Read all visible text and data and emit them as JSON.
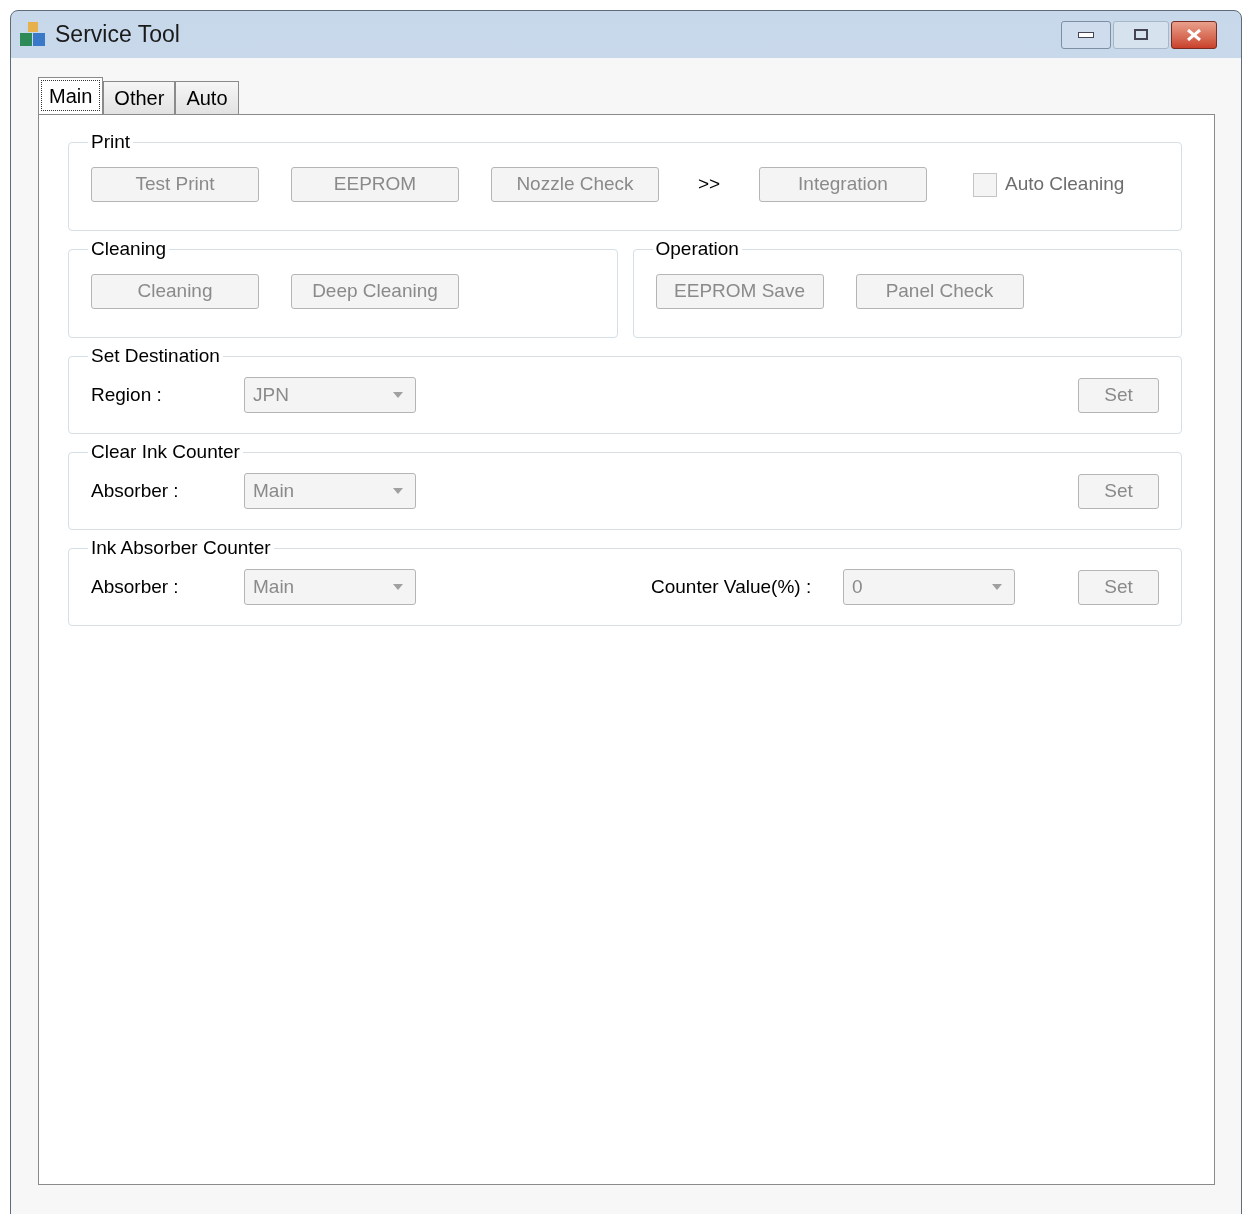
{
  "window": {
    "title": "Service Tool"
  },
  "tabs": [
    {
      "label": "Main",
      "selected": true
    },
    {
      "label": "Other",
      "selected": false
    },
    {
      "label": "Auto",
      "selected": false
    }
  ],
  "sections": [
    {
      "kind": "group",
      "title": "Print",
      "items": [
        {
          "kind": "button",
          "label": "Test Print",
          "disabled": true
        },
        {
          "kind": "button",
          "label": "EEPROM",
          "disabled": true
        },
        {
          "kind": "button",
          "label": "Nozzle Check",
          "disabled": true
        },
        {
          "kind": "text",
          "label": ">>"
        },
        {
          "kind": "button",
          "label": "Integration",
          "disabled": true
        },
        {
          "kind": "checkbox",
          "label": "Auto Cleaning",
          "checked": false,
          "disabled": true
        }
      ]
    },
    {
      "kind": "pair",
      "groups": [
        {
          "title": "Cleaning",
          "items": [
            {
              "kind": "button",
              "label": "Cleaning",
              "disabled": true
            },
            {
              "kind": "button",
              "label": "Deep Cleaning",
              "disabled": true
            }
          ]
        },
        {
          "title": "Operation",
          "items": [
            {
              "kind": "button",
              "label": "EEPROM Save",
              "disabled": true
            },
            {
              "kind": "button",
              "label": "Panel Check",
              "disabled": true
            }
          ]
        }
      ]
    },
    {
      "kind": "group",
      "title": "Set Destination",
      "items": [
        {
          "kind": "label",
          "label": "Region :"
        },
        {
          "kind": "combo",
          "value": "JPN",
          "disabled": true
        },
        {
          "kind": "button",
          "label": "Set",
          "disabled": true
        }
      ]
    },
    {
      "kind": "group",
      "title": "Clear Ink Counter",
      "items": [
        {
          "kind": "label",
          "label": "Absorber :"
        },
        {
          "kind": "combo",
          "value": "Main",
          "disabled": true
        },
        {
          "kind": "button",
          "label": "Set",
          "disabled": true
        }
      ]
    },
    {
      "kind": "group",
      "title": "Ink Absorber Counter",
      "items": [
        {
          "kind": "label",
          "label": "Absorber :"
        },
        {
          "kind": "combo",
          "value": "Main",
          "disabled": true
        },
        {
          "kind": "label",
          "label": "Counter Value(%) :"
        },
        {
          "kind": "combo",
          "value": "0",
          "disabled": true
        },
        {
          "kind": "button",
          "label": "Set",
          "disabled": true
        }
      ]
    }
  ]
}
